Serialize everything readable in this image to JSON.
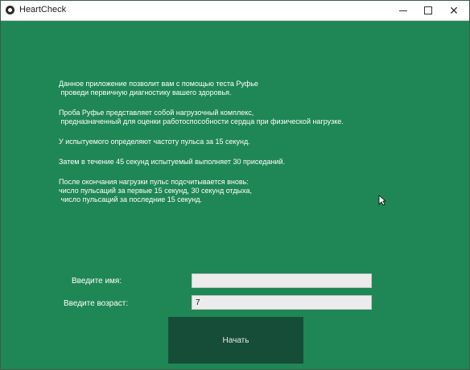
{
  "window": {
    "title": "HeartCheck",
    "controls": {
      "minimize": "minimize-icon",
      "maximize": "maximize-icon",
      "close": "close-icon"
    }
  },
  "info": {
    "paragraphs": [
      "Данное приложение позволит вам с помощью теста Руфье\n проведи первичную диагностику вашего здоровья.",
      "Проба Руфье представляет собой нагрузочный комплекс,\n предназначенный для оценки работоспособности сердца при физической нагрузке.",
      "У испытуемого определяют частоту пульса за 15 секунд.",
      "Затем в течение 45 секунд испытуемый выполняет 30 приседаний.",
      "После окончания нагрузки пульс подсчитывается вновь:\nчисло пульсаций за первые 15 секунд, 30 секунд отдыха,\n число пульсаций за последние 15 секунд."
    ]
  },
  "form": {
    "name_label": "Введите имя:",
    "name_value": "",
    "age_label": "Введите возраст:",
    "age_value": "7"
  },
  "start_button": {
    "label": "Начать"
  },
  "colors": {
    "background": "#1f8755",
    "button": "#164d38",
    "field": "#ececec"
  }
}
